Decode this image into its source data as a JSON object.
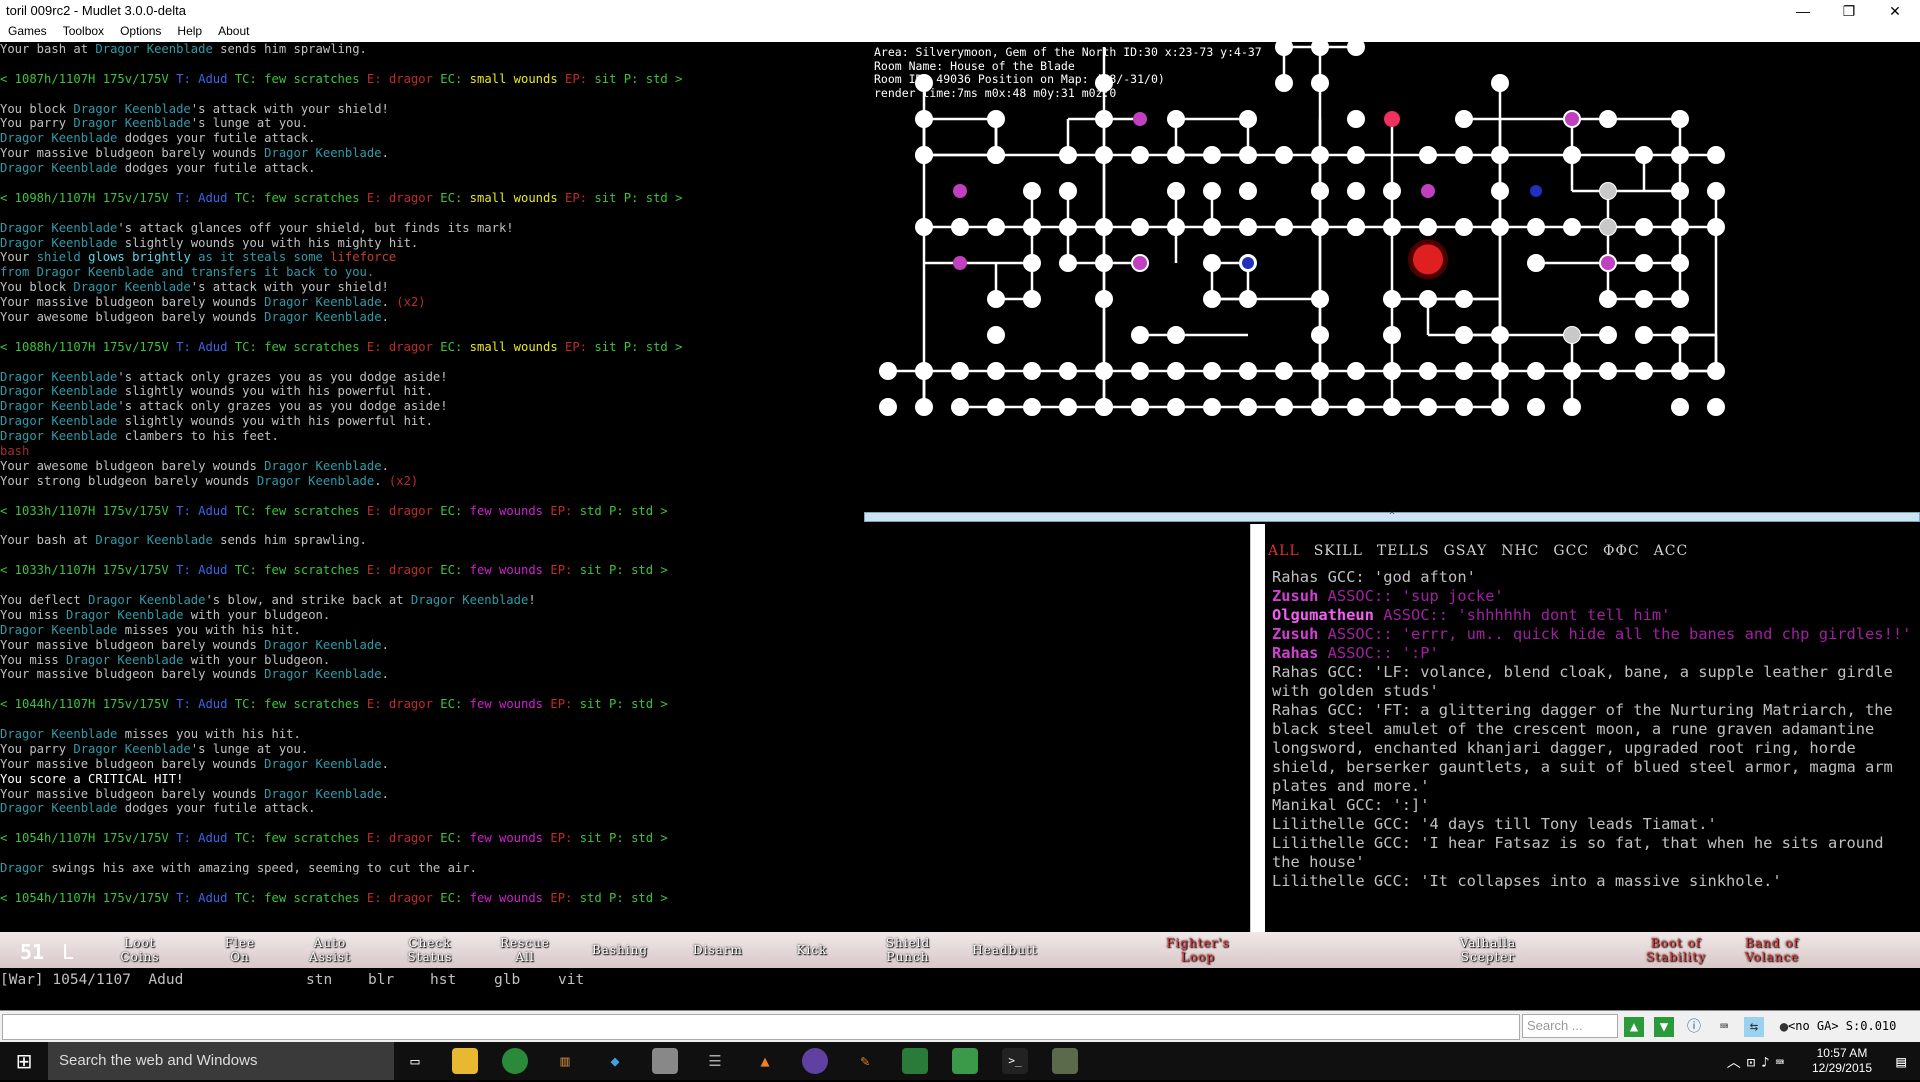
{
  "window": {
    "title": "toril 009rc2 - Mudlet 3.0.0-delta",
    "minimize": "—",
    "restore": "❐",
    "close": "✕"
  },
  "menu": [
    "Games",
    "Toolbox",
    "Options",
    "Help",
    "About"
  ],
  "console_lines": [
    [
      [
        "def",
        "Your bash at "
      ],
      [
        "cyan",
        "Dragor Keenblade"
      ],
      [
        "def",
        " sends him sprawling."
      ]
    ],
    [],
    [
      [
        "grn",
        "< 1087h/1107H 175v/175V "
      ],
      [
        "blu",
        "T: Adud"
      ],
      [
        "grn",
        " TC: few scratches "
      ],
      [
        "red",
        "E: dragor"
      ],
      [
        "grn",
        " EC: "
      ],
      [
        "yel",
        "small wounds"
      ],
      [
        "red",
        " EP:"
      ],
      [
        "grn",
        " sit P: std >"
      ]
    ],
    [],
    [
      [
        "def",
        "You block "
      ],
      [
        "cyan",
        "Dragor Keenblade"
      ],
      [
        "def",
        "'s attack with your shield!"
      ]
    ],
    [
      [
        "def",
        "You parry "
      ],
      [
        "cyan",
        "Dragor Keenblade"
      ],
      [
        "def",
        "'s lunge at you."
      ]
    ],
    [
      [
        "cyan",
        "Dragor Keenblade"
      ],
      [
        "def",
        " dodges your futile attack."
      ]
    ],
    [
      [
        "def",
        "Your massive bludgeon barely wounds "
      ],
      [
        "cyan",
        "Dragor Keenblade"
      ],
      [
        "def",
        "."
      ]
    ],
    [
      [
        "cyan",
        "Dragor Keenblade"
      ],
      [
        "def",
        " dodges your futile attack."
      ]
    ],
    [],
    [
      [
        "grn",
        "< 1098h/1107H 175v/175V "
      ],
      [
        "blu",
        "T: Adud"
      ],
      [
        "grn",
        " TC: few scratches "
      ],
      [
        "red",
        "E: dragor"
      ],
      [
        "grn",
        " EC: "
      ],
      [
        "yel",
        "small wounds"
      ],
      [
        "red",
        " EP:"
      ],
      [
        "grn",
        " sit P: std >"
      ]
    ],
    [],
    [
      [
        "cyan",
        "Dragor Keenblade"
      ],
      [
        "def",
        "'s attack glances off your shield, but finds its mark!"
      ]
    ],
    [
      [
        "cyan",
        "Dragor Keenblade"
      ],
      [
        "def",
        " slightly wounds you with his mighty hit."
      ]
    ],
    [
      [
        "def",
        "Your "
      ],
      [
        "cyan",
        "shield "
      ],
      [
        "bcyan",
        "glows brightly"
      ],
      [
        "cyan",
        " as it steals some "
      ],
      [
        "orn",
        "lifeforce"
      ]
    ],
    [
      [
        "cyan",
        "from Dragor Keenblade and transfers it back to you."
      ]
    ],
    [
      [
        "def",
        "You block "
      ],
      [
        "cyan",
        "Dragor Keenblade"
      ],
      [
        "def",
        "'s attack with your shield!"
      ]
    ],
    [
      [
        "def",
        "Your massive bludgeon barely wounds "
      ],
      [
        "cyan",
        "Dragor Keenblade"
      ],
      [
        "def",
        ". "
      ],
      [
        "red",
        "(x2)"
      ]
    ],
    [
      [
        "def",
        "Your awesome bludgeon barely wounds "
      ],
      [
        "cyan",
        "Dragor Keenblade"
      ],
      [
        "def",
        "."
      ]
    ],
    [],
    [
      [
        "grn",
        "< 1088h/1107H 175v/175V "
      ],
      [
        "blu",
        "T: Adud"
      ],
      [
        "grn",
        " TC: few scratches "
      ],
      [
        "red",
        "E: dragor"
      ],
      [
        "grn",
        " EC: "
      ],
      [
        "yel",
        "small wounds"
      ],
      [
        "red",
        " EP:"
      ],
      [
        "grn",
        " sit P: std >"
      ]
    ],
    [],
    [
      [
        "cyan",
        "Dragor Keenblade"
      ],
      [
        "def",
        "'s attack only grazes you as you dodge aside!"
      ]
    ],
    [
      [
        "cyan",
        "Dragor Keenblade"
      ],
      [
        "def",
        " slightly wounds you with his powerful hit."
      ]
    ],
    [
      [
        "cyan",
        "Dragor Keenblade"
      ],
      [
        "def",
        "'s attack only grazes you as you dodge aside!"
      ]
    ],
    [
      [
        "cyan",
        "Dragor Keenblade"
      ],
      [
        "def",
        " slightly wounds you with his powerful hit."
      ]
    ],
    [
      [
        "cyan",
        "Dragor Keenblade"
      ],
      [
        "def",
        " clambers to his feet."
      ]
    ],
    [
      [
        "dred",
        "bash"
      ]
    ],
    [
      [
        "def",
        "Your awesome bludgeon barely wounds "
      ],
      [
        "cyan",
        "Dragor Keenblade"
      ],
      [
        "def",
        "."
      ]
    ],
    [
      [
        "def",
        "Your strong bludgeon barely wounds "
      ],
      [
        "cyan",
        "Dragor Keenblade"
      ],
      [
        "def",
        ". "
      ],
      [
        "red",
        "(x2)"
      ]
    ],
    [],
    [
      [
        "grn",
        "< 1033h/1107H 175v/175V "
      ],
      [
        "blu",
        "T: Adud"
      ],
      [
        "grn",
        " TC: few scratches "
      ],
      [
        "red",
        "E: dragor"
      ],
      [
        "grn",
        " EC: "
      ],
      [
        "mag",
        "few wounds"
      ],
      [
        "red",
        " EP:"
      ],
      [
        "grn",
        " std P: std >"
      ]
    ],
    [],
    [
      [
        "def",
        "Your bash at "
      ],
      [
        "cyan",
        "Dragor Keenblade"
      ],
      [
        "def",
        " sends him sprawling."
      ]
    ],
    [],
    [
      [
        "grn",
        "< 1033h/1107H 175v/175V "
      ],
      [
        "blu",
        "T: Adud"
      ],
      [
        "grn",
        " TC: few scratches "
      ],
      [
        "red",
        "E: dragor"
      ],
      [
        "grn",
        " EC: "
      ],
      [
        "mag",
        "few wounds"
      ],
      [
        "red",
        " EP:"
      ],
      [
        "grn",
        " sit P: std >"
      ]
    ],
    [],
    [
      [
        "def",
        "You deflect "
      ],
      [
        "cyan",
        "Dragor Keenblade"
      ],
      [
        "def",
        "'s blow, and strike back at "
      ],
      [
        "cyan",
        "Dragor Keenblade"
      ],
      [
        "def",
        "!"
      ]
    ],
    [
      [
        "def",
        "You miss "
      ],
      [
        "cyan",
        "Dragor Keenblade"
      ],
      [
        "def",
        " with your bludgeon."
      ]
    ],
    [
      [
        "cyan",
        "Dragor Keenblade"
      ],
      [
        "def",
        " misses you with his hit."
      ]
    ],
    [
      [
        "def",
        "Your massive bludgeon barely wounds "
      ],
      [
        "cyan",
        "Dragor Keenblade"
      ],
      [
        "def",
        "."
      ]
    ],
    [
      [
        "def",
        "You miss "
      ],
      [
        "cyan",
        "Dragor Keenblade"
      ],
      [
        "def",
        " with your bludgeon."
      ]
    ],
    [
      [
        "def",
        "Your massive bludgeon barely wounds "
      ],
      [
        "cyan",
        "Dragor Keenblade"
      ],
      [
        "def",
        "."
      ]
    ],
    [],
    [
      [
        "grn",
        "< 1044h/1107H 175v/175V "
      ],
      [
        "blu",
        "T: Adud"
      ],
      [
        "grn",
        " TC: few scratches "
      ],
      [
        "red",
        "E: dragor"
      ],
      [
        "grn",
        " EC: "
      ],
      [
        "mag",
        "few wounds"
      ],
      [
        "red",
        " EP:"
      ],
      [
        "grn",
        " sit P: std >"
      ]
    ],
    [],
    [
      [
        "cyan",
        "Dragor Keenblade"
      ],
      [
        "def",
        " misses you with his hit."
      ]
    ],
    [
      [
        "def",
        "You parry "
      ],
      [
        "cyan",
        "Dragor Keenblade"
      ],
      [
        "def",
        "'s lunge at you."
      ]
    ],
    [
      [
        "def",
        "Your massive bludgeon barely wounds "
      ],
      [
        "cyan",
        "Dragor Keenblade"
      ],
      [
        "def",
        "."
      ]
    ],
    [
      [
        "wht",
        "You score a CRITICAL HIT!"
      ]
    ],
    [
      [
        "def",
        "Your massive bludgeon barely wounds "
      ],
      [
        "cyan",
        "Dragor Keenblade"
      ],
      [
        "def",
        "."
      ]
    ],
    [
      [
        "cyan",
        "Dragor Keenblade"
      ],
      [
        "def",
        " dodges your futile attack."
      ]
    ],
    [],
    [
      [
        "grn",
        "< 1054h/1107H 175v/175V "
      ],
      [
        "blu",
        "T: Adud"
      ],
      [
        "grn",
        " TC: few scratches "
      ],
      [
        "red",
        "E: dragor"
      ],
      [
        "grn",
        " EC: "
      ],
      [
        "mag",
        "few wounds"
      ],
      [
        "red",
        " EP:"
      ],
      [
        "grn",
        " sit P: std >"
      ]
    ],
    [],
    [
      [
        "cyan",
        "Dragor"
      ],
      [
        "def",
        " swings his axe with amazing speed, seeming to cut the air."
      ]
    ],
    [],
    [
      [
        "grn",
        "< 1054h/1107H 175v/175V "
      ],
      [
        "blu",
        "T: Adud"
      ],
      [
        "grn",
        " TC: few scratches "
      ],
      [
        "red",
        "E: dragor"
      ],
      [
        "grn",
        " EC: "
      ],
      [
        "mag",
        "few wounds"
      ],
      [
        "red",
        " EP:"
      ],
      [
        "grn",
        " std P: std >"
      ]
    ]
  ],
  "map": {
    "info": [
      "Area: Silverymoon, Gem of the North ID:30 x:23-73 y:4-37",
      "Room Name: House of the Blade",
      "Room ID: 49036 Position on Map: (48/-31/0)",
      "render time:7ms m0x:48 m0y:31 m0z:0"
    ],
    "colors": {
      "room": "#ffffff",
      "special": "#c040c0",
      "current": "#e02020",
      "blue": "#2030c0",
      "grey": "#c8c8c8"
    }
  },
  "splitter": "^",
  "chat": {
    "tabs": [
      "ALL",
      "SKILL",
      "TELLS",
      "GSAY",
      "NHC",
      "GCC",
      "ΦΦC",
      "ACC"
    ],
    "messages": [
      {
        "cls": "def",
        "text": "Rahas GCC: 'god afton'"
      },
      {
        "cls": "mag",
        "name": "Zusuh",
        "text": " ASSOC:: 'sup jocke'"
      },
      {
        "cls": "bmag",
        "name": "Olgumatheun",
        "text": " ASSOC:: 'shhhhhh dont tell him'"
      },
      {
        "cls": "mag",
        "name": "Zusuh",
        "text": " ASSOC:: 'errr, um.. quick hide all the banes and chp girdles!!'"
      },
      {
        "cls": "mag",
        "name": "Rahas",
        "text": " ASSOC:: ':P'"
      },
      {
        "cls": "def",
        "text": "Rahas GCC: 'LF: volance, blend cloak, bane, a supple leather girdle with golden studs'"
      },
      {
        "cls": "def",
        "text": "Rahas GCC: 'FT: a glittering dagger of the Nurturing Matriarch, the black steel amulet of the crescent moon, a rune graven adamantine longsword, enchanted khanjari dagger, upgraded root ring, horde shield, berserker gauntlets, a suit of blued steel armor, magma arm plates and more.'"
      },
      {
        "cls": "def",
        "text": "Manikal GCC: ':]'"
      },
      {
        "cls": "def",
        "text": "Lilithelle GCC: '4 days till Tony leads Tiamat.'"
      },
      {
        "cls": "def",
        "text": "Lilithelle GCC: 'I hear Fatsaz is so fat, that when he sits around the house'"
      },
      {
        "cls": "def",
        "text": "Lilithelle GCC: 'It collapses into a massive sinkhole.'"
      }
    ]
  },
  "buttons": {
    "bignum": "51",
    "bigl": "L",
    "items": [
      {
        "l1": "Loot",
        "l2": "Coins"
      },
      {
        "l1": "Flee",
        "l2": "On"
      },
      {
        "l1": "Auto",
        "l2": "Assist"
      },
      {
        "l1": "Check",
        "l2": "Status"
      },
      {
        "l1": "Rescue",
        "l2": "All"
      },
      {
        "l1": "Bashing",
        "l2": ""
      },
      {
        "l1": "Disarm",
        "l2": ""
      },
      {
        "l1": "Kick",
        "l2": ""
      },
      {
        "l1": "Shield",
        "l2": "Punch"
      },
      {
        "l1": "Headbutt",
        "l2": ""
      },
      {
        "l1": "Fighter's",
        "l2": "Loop"
      },
      {
        "l1": "Valhalla",
        "l2": "Scepter"
      },
      {
        "l1": "Boot of",
        "l2": "Stability"
      },
      {
        "l1": "Band of",
        "l2": "Volance"
      }
    ]
  },
  "status": {
    "line": "[War] 1054/1107  Adud",
    "affects": [
      "stn",
      "blr",
      "hst",
      "glb",
      "vit"
    ]
  },
  "input": {
    "search_placeholder": "Search ...",
    "nogas": "<no GA> S:0.010"
  },
  "taskbar": {
    "start_icon": "windows-icon",
    "search_placeholder": "Search the web and Windows",
    "time": "10:57 AM",
    "date": "12/29/2015"
  }
}
